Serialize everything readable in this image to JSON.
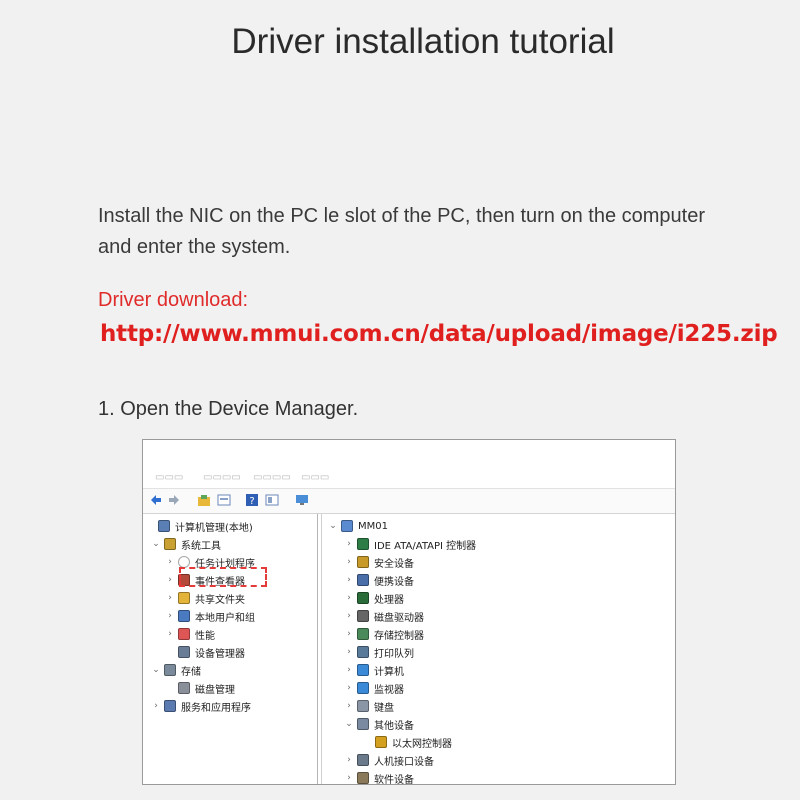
{
  "title": "Driver installation tutorial",
  "intro": "Install the NIC on the PC le slot of the PC, then turn on the computer and enter the system.",
  "download": {
    "label": "Driver download:",
    "url": "http://www.mmui.com.cn/data/upload/image/i225.zip"
  },
  "step1": "1. Open the Device Manager.",
  "screenshot": {
    "left_tree": [
      {
        "label": "计算机管理(本地)",
        "icon": "computer-management-icon"
      },
      {
        "label": "系统工具",
        "icon": "tools-icon"
      },
      {
        "label": "任务计划程序",
        "icon": "clock-icon"
      },
      {
        "label": "事件查看器",
        "icon": "event-viewer-icon"
      },
      {
        "label": "共享文件夹",
        "icon": "shared-folder-icon"
      },
      {
        "label": "本地用户和组",
        "icon": "users-icon"
      },
      {
        "label": "性能",
        "icon": "performance-icon"
      },
      {
        "label": "设备管理器",
        "icon": "device-manager-icon"
      },
      {
        "label": "存储",
        "icon": "storage-icon"
      },
      {
        "label": "磁盘管理",
        "icon": "disk-management-icon"
      },
      {
        "label": "服务和应用程序",
        "icon": "services-icon"
      }
    ],
    "right_tree": [
      {
        "label": "MM01",
        "icon": "computer-icon"
      },
      {
        "label": "IDE ATA/ATAPI 控制器",
        "icon": "ide-controller-icon"
      },
      {
        "label": "安全设备",
        "icon": "security-device-icon"
      },
      {
        "label": "便携设备",
        "icon": "portable-device-icon"
      },
      {
        "label": "处理器",
        "icon": "processor-icon"
      },
      {
        "label": "磁盘驱动器",
        "icon": "disk-drive-icon"
      },
      {
        "label": "存储控制器",
        "icon": "storage-controller-icon"
      },
      {
        "label": "打印队列",
        "icon": "printer-icon"
      },
      {
        "label": "计算机",
        "icon": "monitor-icon"
      },
      {
        "label": "监视器",
        "icon": "monitor-icon"
      },
      {
        "label": "键盘",
        "icon": "keyboard-icon"
      },
      {
        "label": "其他设备",
        "icon": "other-devices-icon"
      },
      {
        "label": "以太网控制器",
        "icon": "ethernet-warning-icon"
      },
      {
        "label": "人机接口设备",
        "icon": "hid-icon"
      },
      {
        "label": "软件设备",
        "icon": "software-device-icon"
      }
    ]
  }
}
